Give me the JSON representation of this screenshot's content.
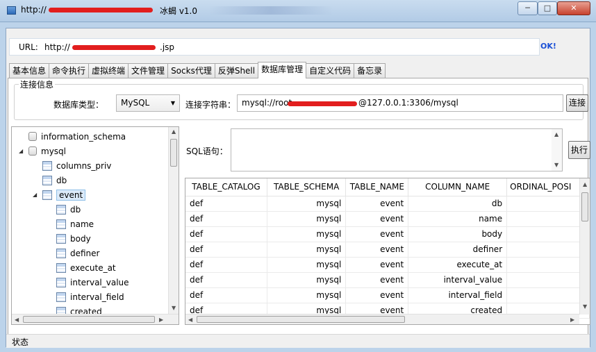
{
  "window": {
    "title_url": "http://",
    "title_app": "冰蝎 v1.0",
    "min_glyph": "─",
    "max_glyph": "□",
    "close_glyph": "✕"
  },
  "url_bar": {
    "label": "URL:",
    "value_prefix": "http://",
    "value_suffix": ".jsp",
    "status": "OK!"
  },
  "tabs": [
    {
      "label": "基本信息"
    },
    {
      "label": "命令执行"
    },
    {
      "label": "虚拟终端"
    },
    {
      "label": "文件管理"
    },
    {
      "label": "Socks代理"
    },
    {
      "label": "反弹Shell"
    },
    {
      "label": "数据库管理"
    },
    {
      "label": "自定义代码"
    },
    {
      "label": "备忘录"
    }
  ],
  "active_tab": "数据库管理",
  "connection": {
    "group_label": "连接信息",
    "db_type_label": "数据库类型：",
    "db_type_value": "MySQL",
    "conn_string_label": "连接字符串：",
    "conn_string_prefix": "mysql://root",
    "conn_string_suffix": "@127.0.0.1:3306/mysql",
    "connect_button": "连接"
  },
  "tree": {
    "nodes": [
      {
        "label": "information_schema",
        "kind": "db-icon"
      },
      {
        "label": "mysql",
        "kind": "db-icon",
        "expanded": true
      },
      {
        "label": "columns_priv",
        "kind": "table-icon"
      },
      {
        "label": "db",
        "kind": "table-icon"
      },
      {
        "label": "event",
        "kind": "table-icon",
        "expanded": true,
        "selected": true
      },
      {
        "label": "db",
        "kind": "table-icon"
      },
      {
        "label": "name",
        "kind": "table-icon"
      },
      {
        "label": "body",
        "kind": "table-icon"
      },
      {
        "label": "definer",
        "kind": "table-icon"
      },
      {
        "label": "execute_at",
        "kind": "table-icon"
      },
      {
        "label": "interval_value",
        "kind": "table-icon"
      },
      {
        "label": "interval_field",
        "kind": "table-icon"
      },
      {
        "label": "created",
        "kind": "table-icon"
      }
    ]
  },
  "sql": {
    "label": "SQL语句：",
    "value": "",
    "execute_button": "执行"
  },
  "grid": {
    "columns": [
      "TABLE_CATALOG",
      "TABLE_SCHEMA",
      "TABLE_NAME",
      "COLUMN_NAME",
      "ORDINAL_POSI"
    ],
    "rows": [
      [
        "def",
        "mysql",
        "event",
        "db",
        ""
      ],
      [
        "def",
        "mysql",
        "event",
        "name",
        ""
      ],
      [
        "def",
        "mysql",
        "event",
        "body",
        ""
      ],
      [
        "def",
        "mysql",
        "event",
        "definer",
        ""
      ],
      [
        "def",
        "mysql",
        "event",
        "execute_at",
        ""
      ],
      [
        "def",
        "mysql",
        "event",
        "interval_value",
        ""
      ],
      [
        "def",
        "mysql",
        "event",
        "interval_field",
        ""
      ],
      [
        "def",
        "mysql",
        "event",
        "created",
        ""
      ]
    ]
  },
  "status_bar": {
    "text": "状态"
  },
  "colors": {
    "ok_status": "#1a4fd6",
    "redaction": "#e21e1e",
    "selection": "#dbeaf9"
  }
}
